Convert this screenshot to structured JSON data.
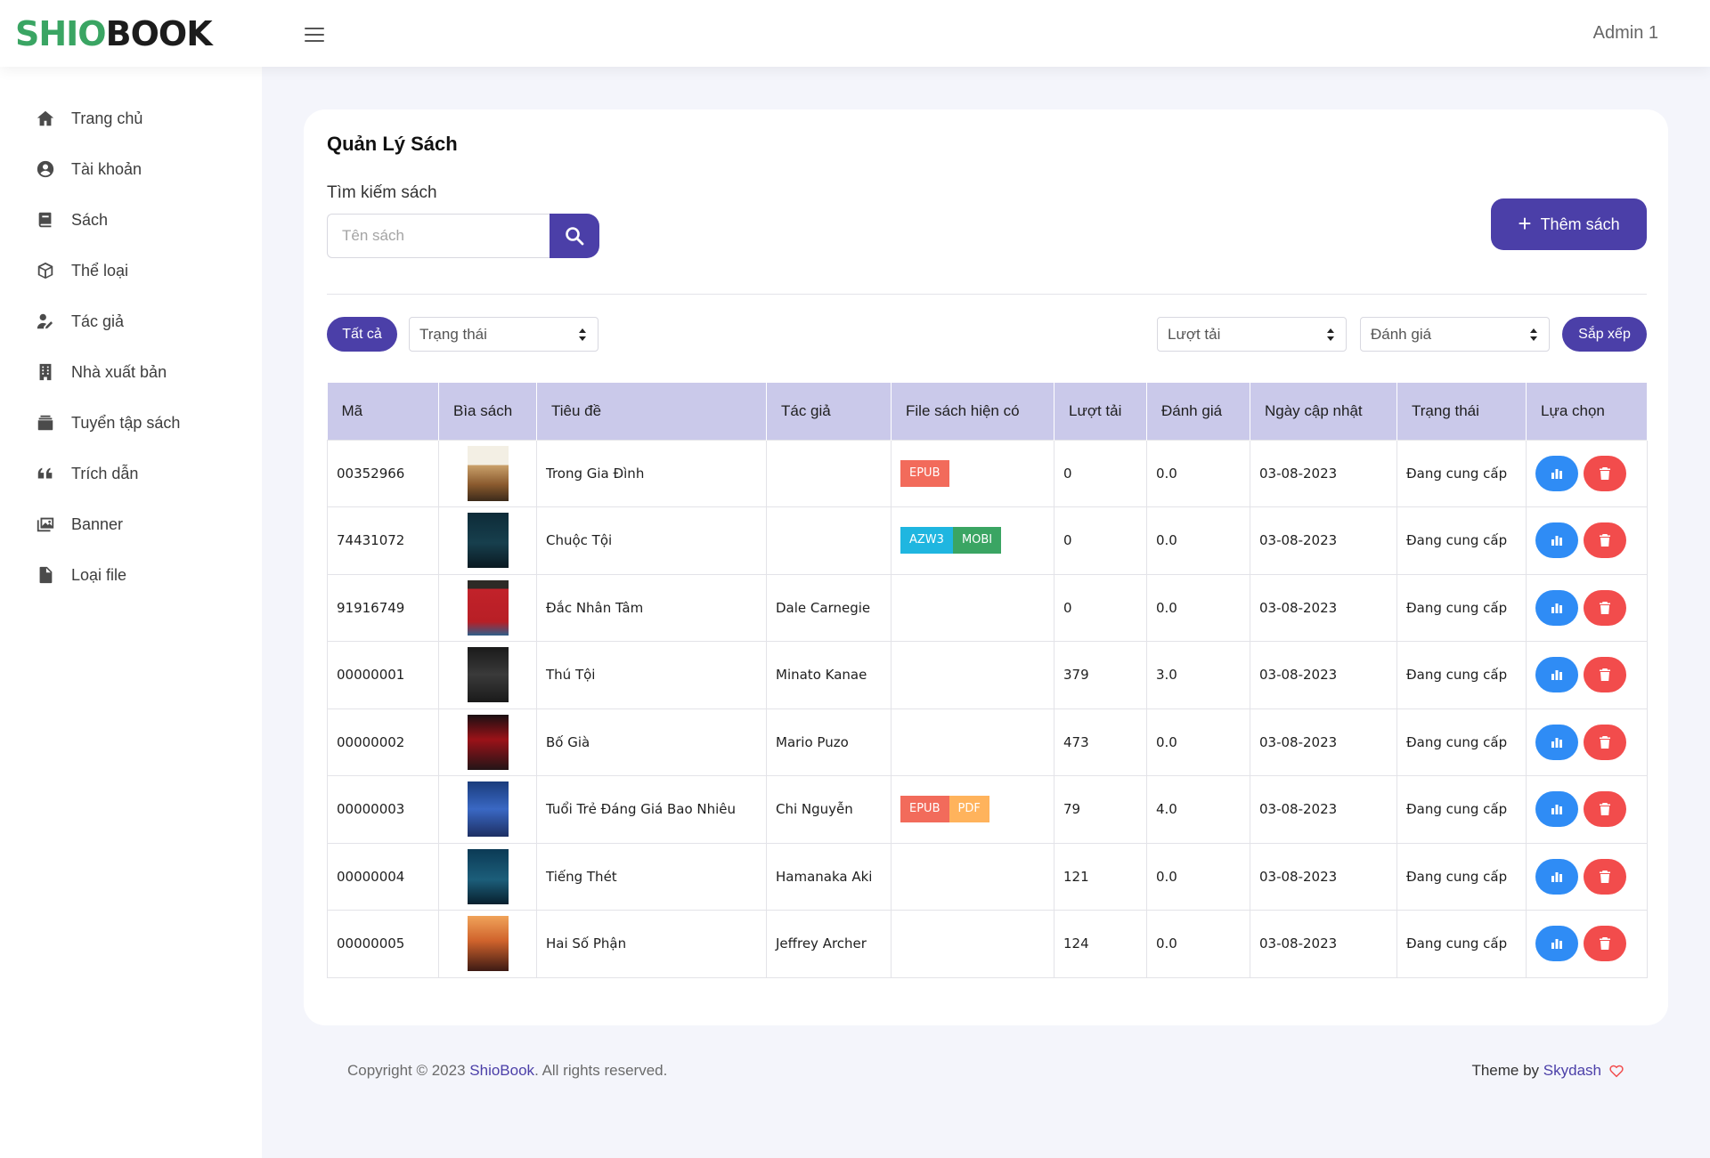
{
  "brand": {
    "part1": "SHIO",
    "part2": "BOOK"
  },
  "header": {
    "user": "Admin 1"
  },
  "sidebar": {
    "items": [
      {
        "label": "Trang chủ",
        "icon": "home-icon"
      },
      {
        "label": "Tài khoản",
        "icon": "user-circle-icon"
      },
      {
        "label": "Sách",
        "icon": "book-icon"
      },
      {
        "label": "Thể loại",
        "icon": "box-icon"
      },
      {
        "label": "Tác giả",
        "icon": "user-pen-icon"
      },
      {
        "label": "Nhà xuất bản",
        "icon": "building-icon"
      },
      {
        "label": "Tuyển tập sách",
        "icon": "collection-icon"
      },
      {
        "label": "Trích dẫn",
        "icon": "quote-icon"
      },
      {
        "label": "Banner",
        "icon": "images-icon"
      },
      {
        "label": "Loại file",
        "icon": "file-icon"
      }
    ]
  },
  "page": {
    "title": "Quản Lý Sách",
    "search_label": "Tìm kiếm sách",
    "search_placeholder": "Tên sách",
    "add_button": "Thêm sách"
  },
  "filters": {
    "all_button": "Tất cả",
    "status_select": "Trạng thái",
    "downloads_select": "Lượt tải",
    "rating_select": "Đánh giá",
    "sort_button": "Sắp xếp"
  },
  "table": {
    "headers": [
      "Mã",
      "Bìa sách",
      "Tiêu đề",
      "Tác giả",
      "File sách hiện có",
      "Lượt tải",
      "Đánh giá",
      "Ngày cập nhật",
      "Trạng thái",
      "Lựa chọn"
    ],
    "rows": [
      {
        "id": "00352966",
        "title": "Trong Gia Đình",
        "author": "",
        "files": [
          "EPUB"
        ],
        "downloads": "0",
        "rating": "0.0",
        "updated": "03-08-2023",
        "status": "Đang cung cấp"
      },
      {
        "id": "74431072",
        "title": "Chuộc Tội",
        "author": "",
        "files": [
          "AZW3",
          "MOBI"
        ],
        "downloads": "0",
        "rating": "0.0",
        "updated": "03-08-2023",
        "status": "Đang cung cấp"
      },
      {
        "id": "91916749",
        "title": "Đắc Nhân Tâm",
        "author": "Dale Carnegie",
        "files": [],
        "downloads": "0",
        "rating": "0.0",
        "updated": "03-08-2023",
        "status": "Đang cung cấp"
      },
      {
        "id": "00000001",
        "title": "Thú Tội",
        "author": "Minato Kanae",
        "files": [],
        "downloads": "379",
        "rating": "3.0",
        "updated": "03-08-2023",
        "status": "Đang cung cấp"
      },
      {
        "id": "00000002",
        "title": "Bố Già",
        "author": "Mario Puzo",
        "files": [],
        "downloads": "473",
        "rating": "0.0",
        "updated": "03-08-2023",
        "status": "Đang cung cấp"
      },
      {
        "id": "00000003",
        "title": "Tuổi Trẻ Đáng Giá Bao Nhiêu",
        "author": "Chi Nguyễn",
        "files": [
          "EPUB",
          "PDF"
        ],
        "downloads": "79",
        "rating": "4.0",
        "updated": "03-08-2023",
        "status": "Đang cung cấp"
      },
      {
        "id": "00000004",
        "title": "Tiếng Thét",
        "author": "Hamanaka Aki",
        "files": [],
        "downloads": "121",
        "rating": "0.0",
        "updated": "03-08-2023",
        "status": "Đang cung cấp"
      },
      {
        "id": "00000005",
        "title": "Hai Số Phận",
        "author": "Jeffrey Archer",
        "files": [],
        "downloads": "124",
        "rating": "0.0",
        "updated": "03-08-2023",
        "status": "Đang cung cấp"
      }
    ]
  },
  "file_colors": {
    "EPUB": "#f26b5b",
    "AZW3": "#1fb6e0",
    "MOBI": "#3aa563",
    "PDF": "#ffb35c"
  },
  "colors": {
    "accent": "#4b3fa8",
    "stats_button": "#2f8cf5",
    "delete_button": "#f24c4c",
    "logo_green": "#3aa563"
  },
  "footer": {
    "copyright_prefix": "Copyright © 2023 ",
    "brand_link": "ShioBook",
    "copyright_suffix": ". All rights reserved.",
    "theme_prefix": "Theme by ",
    "theme_link": "Skydash"
  }
}
